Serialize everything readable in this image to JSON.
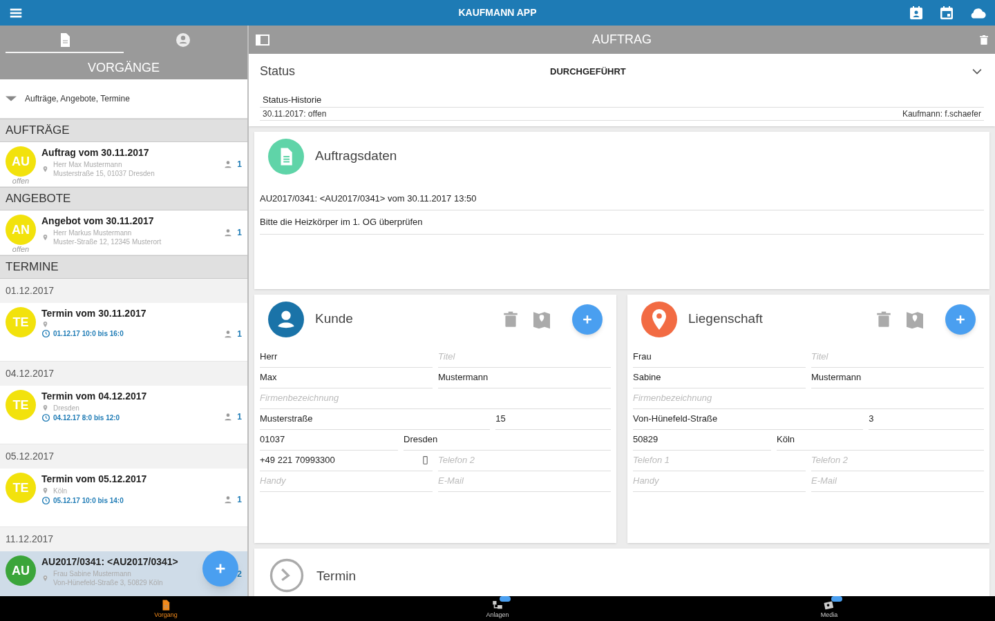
{
  "app_bar": {
    "title": "KAUFMANN APP"
  },
  "sidebar": {
    "tabs": [
      {
        "kind": "document",
        "selected": true
      },
      {
        "kind": "person",
        "selected": false
      }
    ],
    "title": "VORGÄNGE",
    "filter": "Aufträge, Angebote, Termine",
    "entries": [
      {
        "kind": "section",
        "label": "AUFTRÄGE"
      },
      {
        "kind": "item",
        "badge": "AU",
        "color": "#f2e20c",
        "title": "Auftrag vom 30.11.2017",
        "lines": [
          "Herr Max Mustermann",
          "Musterstraße 15, 01037 Dresden"
        ],
        "status": "offen",
        "count": "1",
        "selected": false
      },
      {
        "kind": "section",
        "label": "ANGEBOTE"
      },
      {
        "kind": "item",
        "badge": "AN",
        "color": "#f2e20c",
        "title": "Angebot vom 30.11.2017",
        "lines": [
          "Herr Markus Mustermann",
          "Muster-Straße 12, 12345 Musterort"
        ],
        "status": "offen",
        "count": "1",
        "selected": false
      },
      {
        "kind": "section",
        "label": "TERMINE"
      },
      {
        "kind": "date",
        "label": "01.12.2017"
      },
      {
        "kind": "item",
        "badge": "TE",
        "color": "#f2e20c",
        "title": "Termin vom 30.11.2017",
        "time": "01.12.17 10:0 bis 16:0",
        "count": "1",
        "selected": false
      },
      {
        "kind": "date",
        "label": "04.12.2017"
      },
      {
        "kind": "item",
        "badge": "TE",
        "color": "#f2e20c",
        "title": "Termin vom 04.12.2017",
        "lines": [
          "Dresden"
        ],
        "time": "04.12.17 8:0 bis 12:0",
        "count": "1",
        "selected": false
      },
      {
        "kind": "date",
        "label": "05.12.2017"
      },
      {
        "kind": "item",
        "badge": "TE",
        "color": "#f2e20c",
        "title": "Termin vom 05.12.2017",
        "lines": [
          "Köln"
        ],
        "time": "05.12.17 10:0 bis 14:0",
        "count": "1",
        "selected": false
      },
      {
        "kind": "date",
        "label": "11.12.2017"
      },
      {
        "kind": "item",
        "badge": "AU",
        "color": "#3ba53a",
        "title": "AU2017/0341: <AU2017/0341>",
        "lines": [
          "Frau Sabine Mustermann",
          "Von-Hünefeld-Straße 3, 50829 Köln"
        ],
        "count": "2",
        "selected": true
      }
    ]
  },
  "detail": {
    "title": "AUFTRAG",
    "status": {
      "label": "Status",
      "value": "DURCHGEFÜHRT",
      "history_label": "Status-Historie",
      "history_entry": "30.11.2017: offen",
      "history_user": "Kaufmann: f.schaefer"
    },
    "order_data": {
      "title": "Auftragsdaten",
      "lines": [
        "AU2017/0341: <AU2017/0341> vom 30.11.2017 13:50",
        "Bitte die Heizkörper im 1. OG überprüfen"
      ]
    },
    "cards": [
      {
        "kind": "customer",
        "title": "Kunde",
        "rows": [
          [
            {
              "value": "Herr"
            },
            {
              "placeholder": "Titel"
            }
          ],
          [
            {
              "value": "Max"
            },
            {
              "value": "Mustermann"
            }
          ],
          [
            {
              "placeholder": "Firmenbezeichnung"
            }
          ],
          [
            {
              "value": "Musterstraße"
            },
            {
              "value": "15"
            }
          ],
          [
            {
              "value": "01037"
            },
            {
              "value": "Dresden"
            }
          ],
          [
            {
              "value": "+49 221 70993300",
              "kind": "mobile"
            },
            {
              "placeholder": "Telefon 2"
            }
          ],
          [
            {
              "placeholder": "Handy"
            },
            {
              "placeholder": "E-Mail"
            }
          ]
        ]
      },
      {
        "kind": "property",
        "title": "Liegenschaft",
        "rows": [
          [
            {
              "value": "Frau"
            },
            {
              "placeholder": "Titel"
            }
          ],
          [
            {
              "value": "Sabine"
            },
            {
              "value": "Mustermann"
            }
          ],
          [
            {
              "placeholder": "Firmenbezeichnung"
            }
          ],
          [
            {
              "value": "Von-Hünefeld-Straße"
            },
            {
              "value": "3"
            }
          ],
          [
            {
              "value": "50829"
            },
            {
              "value": "Köln"
            }
          ],
          [
            {
              "placeholder": "Telefon 1"
            },
            {
              "placeholder": "Telefon 2"
            }
          ],
          [
            {
              "placeholder": "Handy"
            },
            {
              "placeholder": "E-Mail"
            }
          ]
        ]
      }
    ],
    "appointment": {
      "title": "Termin"
    }
  },
  "bottom_nav": [
    {
      "kind": "document",
      "label": "Vorgang",
      "selected": true
    },
    {
      "kind": "equipment",
      "label": "Anlagen",
      "selected": false
    },
    {
      "kind": "media",
      "label": "Media",
      "selected": false
    }
  ]
}
